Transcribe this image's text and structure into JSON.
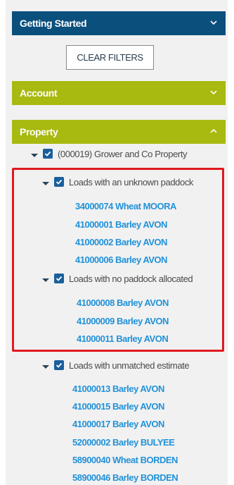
{
  "colors": {
    "getting_started_bg": "#0b4f7d",
    "section_bg": "#a8b90f",
    "checkbox": "#1a5f9c",
    "link": "#2192d9",
    "highlight": "#e0191f"
  },
  "sections": {
    "getting_started": {
      "label": "Getting Started",
      "icon": "chevron-down-icon"
    },
    "account": {
      "label": "Account",
      "icon": "chevron-down-icon"
    },
    "property": {
      "label": "Property",
      "icon": "chevron-up-icon"
    }
  },
  "clear_filters_label": "CLEAR FILTERS",
  "tree": {
    "property_label": "(000019) Grower and Co Property",
    "unknown_paddock": {
      "label": "Loads with an unknown paddock",
      "loads": [
        "34000074 Wheat MOORA",
        "41000001 Barley AVON",
        "41000002 Barley AVON",
        "41000006 Barley AVON"
      ]
    },
    "no_paddock": {
      "label": "Loads with no paddock allocated",
      "loads": [
        "41000008 Barley AVON",
        "41000009 Barley AVON",
        "41000011 Barley AVON"
      ]
    },
    "unmatched_estimate": {
      "label": "Loads with unmatched estimate",
      "loads": [
        "41000013 Barley AVON",
        "41000015 Barley AVON",
        "41000017 Barley AVON",
        "52000002 Barley BULYEE",
        "58900040 Wheat BORDEN",
        "58900046 Barley BORDEN"
      ]
    }
  }
}
